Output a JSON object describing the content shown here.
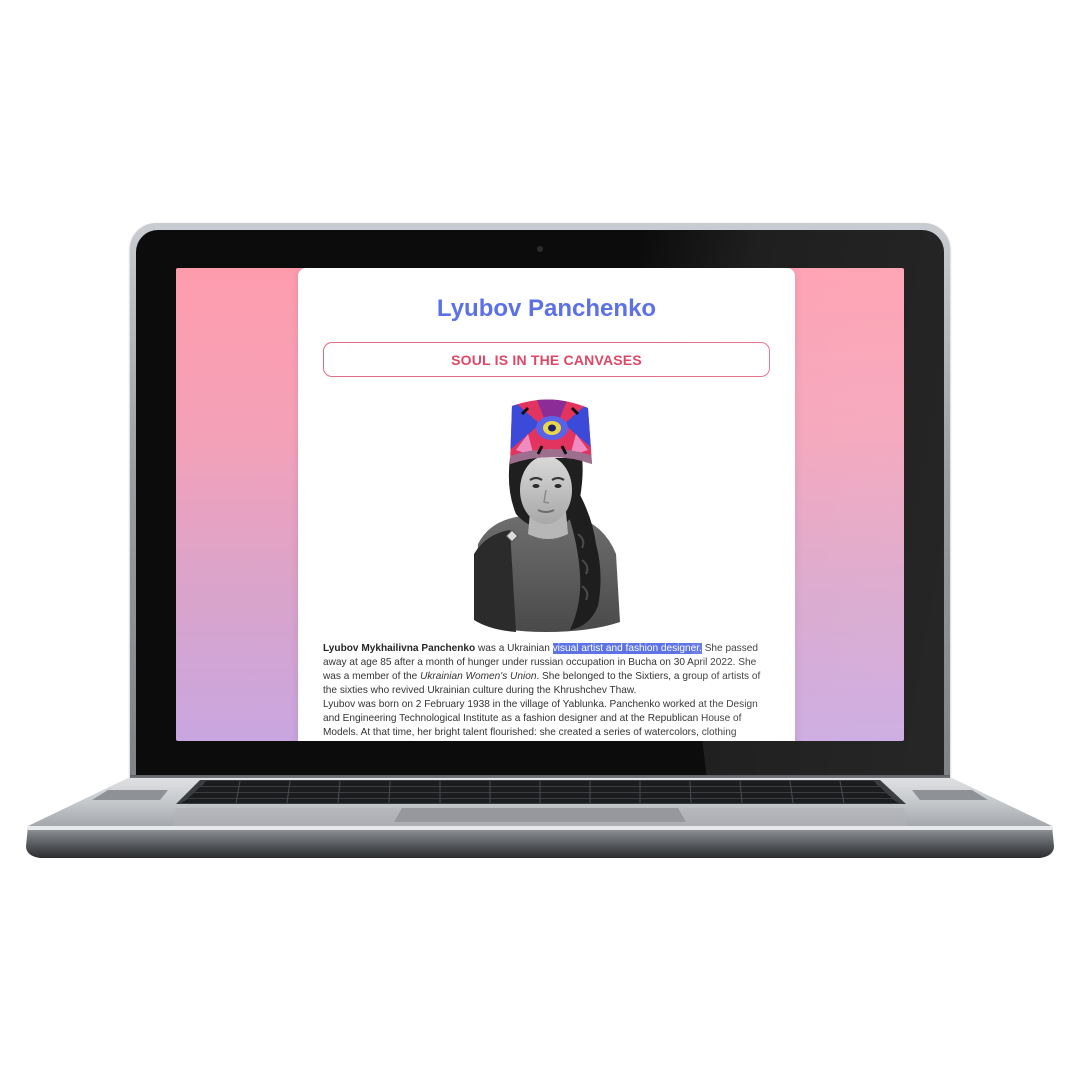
{
  "page": {
    "title": "Lyubov Panchenko",
    "motto": "SOUL IS IN THE CANVASES"
  },
  "bio": {
    "name_bold": "Lyubov Mykhailivna Panchenko",
    "p1_a": " was a Ukrainian ",
    "p1_highlight": "visual artist and fashion designer.",
    "p1_b": " She passed away at age 85 after a month of hunger under russian occupation in Bucha on 30 April 2022. She was a member of the ",
    "p1_italic": "Ukrainian Women's Union",
    "p1_c": ". She belonged to the Sixtiers, a group of artists of the sixties who revived Ukrainian culture during the Khrushchev Thaw.",
    "p2": "Lyubov was born on 2 February 1938 in the village of Yablunka. Panchenko worked at the Design and Engineering Technological Institute as a fashion designer and at the Republican House of Models. At that time, her bright talent flourished: she created a series of watercolors, clothing"
  },
  "colors": {
    "title": "#5c71e6",
    "motto": "#df4766",
    "highlight": "#5e74e4",
    "gradient_top": "#fe9cae",
    "gradient_bottom": "#c9a6e0"
  },
  "icons": {
    "portrait": "portrait-photo-with-embroidered-hat"
  }
}
